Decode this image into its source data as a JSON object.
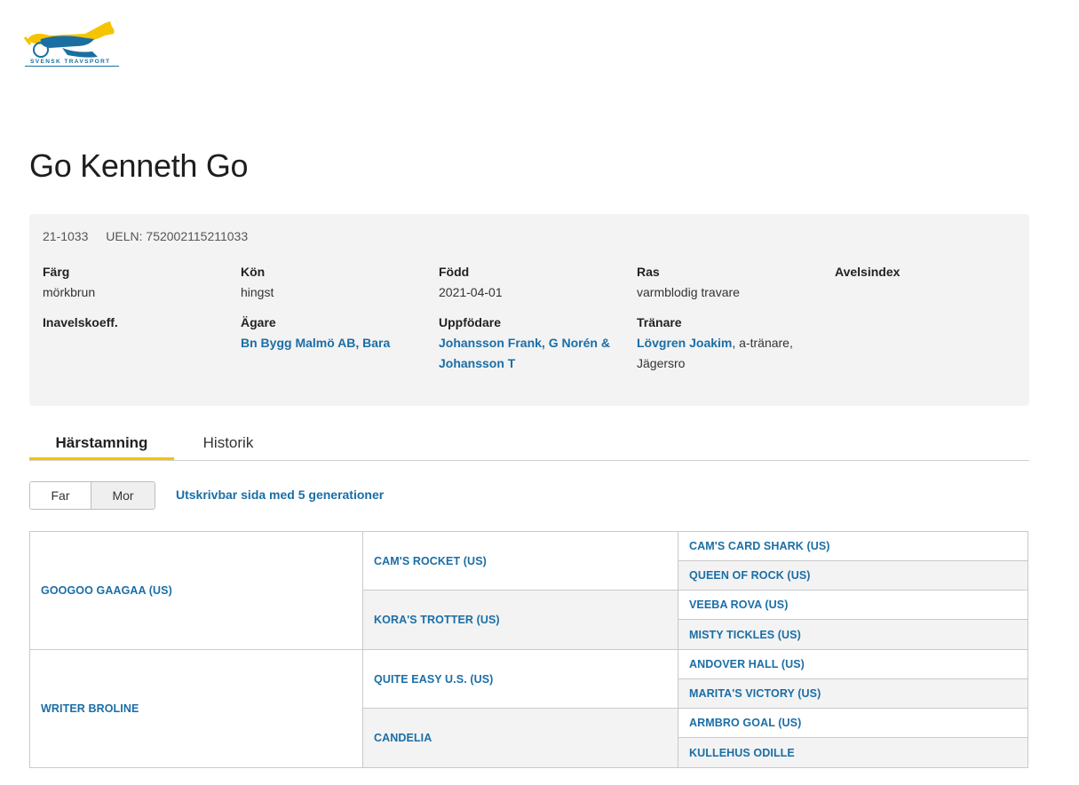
{
  "logo": {
    "text": "SVENSK TRAVSPORT",
    "colors": {
      "yellow": "#f5c400",
      "blue": "#1a6fa0"
    }
  },
  "horse": {
    "name": "Go Kenneth Go",
    "reg_number": "21-1033",
    "ueln": "UELN: 752002115211033"
  },
  "fields": {
    "farg": {
      "label": "Färg",
      "value": "mörkbrun"
    },
    "kon": {
      "label": "Kön",
      "value": "hingst"
    },
    "fodd": {
      "label": "Född",
      "value": "2021-04-01"
    },
    "ras": {
      "label": "Ras",
      "value": "varmblodig travare"
    },
    "avelsindex": {
      "label": "Avelsindex",
      "value": ""
    },
    "inavel": {
      "label": "Inavelskoeff.",
      "value": ""
    },
    "agare": {
      "label": "Ägare",
      "value": "Bn Bygg Malmö AB, Bara"
    },
    "uppfodare": {
      "label": "Uppfödare",
      "value_line1": "Johansson Frank, G Norén &",
      "value_line2": "Johansson T"
    },
    "tranare": {
      "label": "Tränare",
      "name": "Lövgren Joakim",
      "suffix": ", a-tränare,",
      "location": "Jägersro"
    }
  },
  "tabs": [
    {
      "label": "Härstamning",
      "active": true
    },
    {
      "label": "Historik",
      "active": false
    }
  ],
  "toggle": {
    "far": "Far",
    "mor": "Mor"
  },
  "print_link": "Utskrivbar sida med 5 generationer",
  "pedigree": {
    "gen1": [
      "GOOGOO GAAGAA (US)",
      "WRITER BROLINE"
    ],
    "gen2": [
      "CAM'S ROCKET (US)",
      "KORA'S TROTTER (US)",
      "QUITE EASY U.S. (US)",
      "CANDELIA"
    ],
    "gen3": [
      "CAM'S CARD SHARK (US)",
      "QUEEN OF ROCK (US)",
      "VEEBA ROVA (US)",
      "MISTY TICKLES (US)",
      "ANDOVER HALL (US)",
      "MARITA'S VICTORY (US)",
      "ARMBRO GOAL (US)",
      "KULLEHUS ODILLE"
    ]
  },
  "colors": {
    "link": "#1a6ea6",
    "accent": "#f5c400",
    "panel": "#f3f3f3"
  }
}
